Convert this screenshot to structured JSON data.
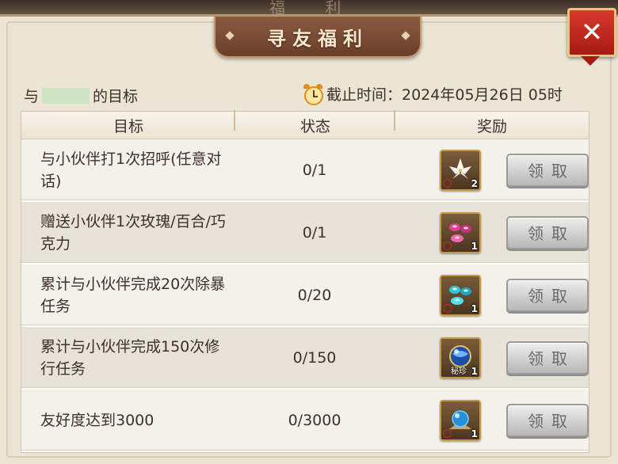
{
  "top_strip_text": "福 利",
  "title": "寻友福利",
  "close_label": "✕",
  "target": {
    "prefix": "与",
    "suffix": "的目标"
  },
  "deadline": {
    "text": "截止时间：2024年05月26日 05时"
  },
  "table": {
    "headers": [
      "目标",
      "状态",
      "奖励"
    ],
    "claim_label": "领取",
    "rows": [
      {
        "goal": "与小伙伴打1次招呼(任意对话)",
        "status": "0/1",
        "reward_count": "2",
        "reward_tag": "",
        "icon": "lily-flower-icon"
      },
      {
        "goal": "赠送小伙伴1次玫瑰/百合/巧克力",
        "status": "0/1",
        "reward_count": "1",
        "reward_tag": "",
        "icon": "pink-gems-icon"
      },
      {
        "goal": "累计与小伙伴完成20次除暴任务",
        "status": "0/20",
        "reward_count": "1",
        "reward_tag": "",
        "icon": "cyan-gems-icon"
      },
      {
        "goal": "累计与小伙伴完成150次修行任务",
        "status": "0/150",
        "reward_count": "1",
        "reward_tag": "秘珍",
        "icon": "blue-orb-icon"
      },
      {
        "goal": "友好度达到3000",
        "status": "0/3000",
        "reward_count": "1",
        "reward_tag": "",
        "icon": "blue-jewel-icon"
      }
    ]
  },
  "colors": {
    "panel_bg": "#ebe5d6",
    "title_banner": "#7a4a33",
    "close_button": "#c42a1c",
    "claim_button": "#d0d0d0"
  }
}
